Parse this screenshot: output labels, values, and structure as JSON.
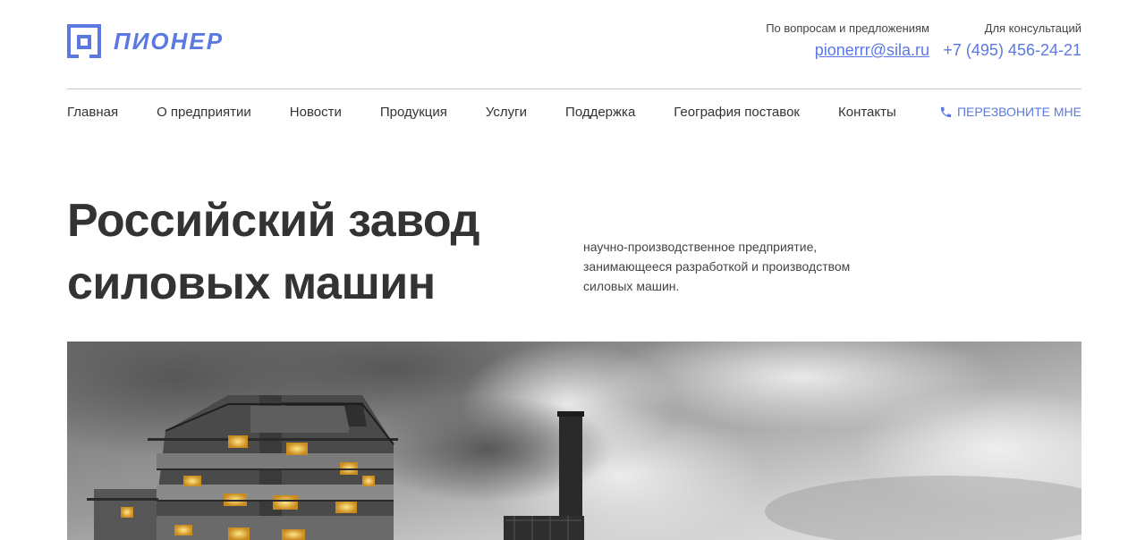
{
  "brand": {
    "name": "ПИОНЕР",
    "color": "#5b79e0",
    "logo_icon": "square-house-logo-icon"
  },
  "contacts": {
    "questions": {
      "label": "По вопросам и предложениям",
      "email": "pionerrr@sila.ru"
    },
    "consult": {
      "label": "Для консультаций",
      "phone": "+7 (495) 456-24-21"
    }
  },
  "nav": {
    "items": [
      "Главная",
      "О предприятии",
      "Новости",
      "Продукция",
      "Услуги",
      "Поддержка",
      "География поставок",
      "Контакты"
    ],
    "callback": {
      "icon": "phone-icon",
      "label": "ПЕРЕЗВОНИТЕ МНЕ"
    }
  },
  "hero": {
    "title_line1": "Российский завод",
    "title_line2": "силовых машин",
    "description_line1": "научно-производственное предприятие,",
    "description_line2": "занимающееся разработкой и производством",
    "description_line3": "силовых машин.",
    "image": "industrial-plant-with-smoking-chimney-photo"
  }
}
